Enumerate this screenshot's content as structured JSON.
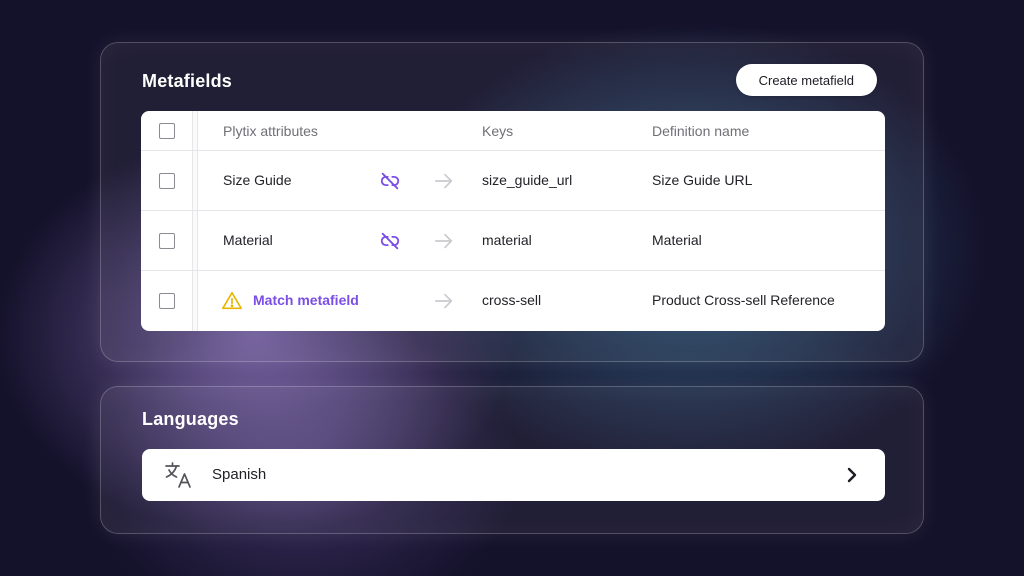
{
  "metafields": {
    "title": "Metafields",
    "create_button": "Create metafield",
    "columns": {
      "attribute": "Plytix attributes",
      "key": "Keys",
      "definition": "Definition name"
    },
    "rows": [
      {
        "attribute": "Size Guide",
        "key": "size_guide_url",
        "definition": "Size Guide URL",
        "linked": true
      },
      {
        "attribute": "Material",
        "key": "material",
        "definition": "Material",
        "linked": true
      },
      {
        "attribute": "Match metafield",
        "key": "cross-sell",
        "definition": "Product Cross-sell Reference",
        "linked": false,
        "warning": true
      }
    ]
  },
  "languages": {
    "title": "Languages",
    "items": [
      {
        "label": "Spanish",
        "icon": "translate-icon"
      }
    ]
  },
  "colors": {
    "accent_purple": "#7b4ee6",
    "warning_yellow": "#e8b400",
    "arrow_gray": "#c9c9cf"
  },
  "icons": {
    "link": "link-broken-icon",
    "arrow": "arrow-right-icon",
    "warning": "warning-icon",
    "chevron": "chevron-right-icon"
  }
}
